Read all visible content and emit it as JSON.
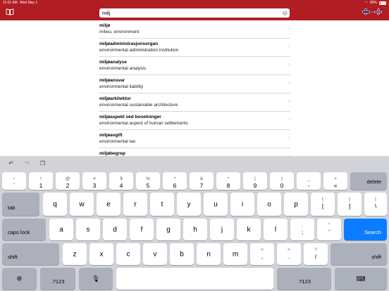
{
  "status": {
    "time": "11:01 AM",
    "date": "Wed May 1",
    "battery": "80%"
  },
  "search": {
    "value": "milj"
  },
  "icons": {
    "book": "book-icon",
    "clear": "clear-icon",
    "flags": "no-to-en-flags"
  },
  "colors": {
    "accent": "#b01d22",
    "search_key": "#0a7cff"
  },
  "results": [
    {
      "word": "miljø",
      "definition": "milieu, environment"
    },
    {
      "word": "miljøadministrasjonsorgan",
      "definition": "environmental administration institution"
    },
    {
      "word": "miljøanalyse",
      "definition": "environmental analysis"
    },
    {
      "word": "miljøansvar",
      "definition": "environmental liability"
    },
    {
      "word": "miljøarkitektur",
      "definition": "environmental sustainable architecture"
    },
    {
      "word": "miljøaspekt ved bosetninger",
      "definition": "environmental aspect of human settlements"
    },
    {
      "word": "miljøavgift",
      "definition": "environmental tax"
    },
    {
      "word": "miljøbegrep",
      "definition": ""
    }
  ],
  "keyboard": {
    "row1": [
      {
        "top": "~",
        "bottom": "`"
      },
      {
        "top": "!",
        "bottom": "1"
      },
      {
        "top": "@",
        "bottom": "2"
      },
      {
        "top": "#",
        "bottom": "3"
      },
      {
        "top": "$",
        "bottom": "4"
      },
      {
        "top": "%",
        "bottom": "5"
      },
      {
        "top": "^",
        "bottom": "6"
      },
      {
        "top": "&",
        "bottom": "7"
      },
      {
        "top": "*",
        "bottom": "8"
      },
      {
        "top": "(",
        "bottom": "9"
      },
      {
        "top": ")",
        "bottom": "0"
      },
      {
        "top": "_",
        "bottom": "-"
      },
      {
        "top": "+",
        "bottom": "="
      }
    ],
    "delete": "delete",
    "tab": "tab",
    "row2": [
      "q",
      "w",
      "e",
      "r",
      "t",
      "y",
      "u",
      "i",
      "o",
      "p"
    ],
    "row2_extra": [
      {
        "top": "{",
        "bottom": "["
      },
      {
        "top": "}",
        "bottom": "]"
      },
      {
        "top": "|",
        "bottom": "\\"
      }
    ],
    "caps": "caps lock",
    "row3": [
      "a",
      "s",
      "d",
      "f",
      "g",
      "h",
      "j",
      "k",
      "l"
    ],
    "row3_extra": [
      {
        "top": ":",
        "bottom": ";"
      },
      {
        "top": "\"",
        "bottom": "'"
      }
    ],
    "search": "Search",
    "shift": "shift",
    "row4": [
      "z",
      "x",
      "c",
      "v",
      "b",
      "n",
      "m"
    ],
    "row4_extra": [
      {
        "top": "<",
        "bottom": ","
      },
      {
        "top": ">",
        "bottom": "."
      },
      {
        "top": "?",
        "bottom": "/"
      }
    ],
    "num": ".?123"
  }
}
